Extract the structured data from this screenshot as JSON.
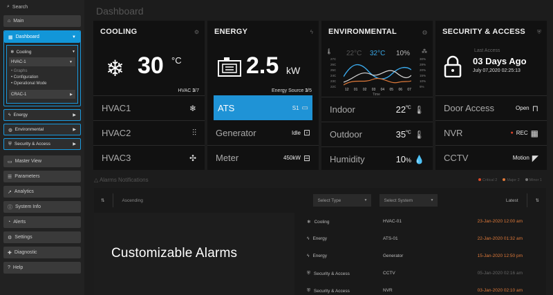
{
  "sidebar": {
    "search_label": "Search",
    "main_label": "Main",
    "dashboard_label": "Dashboard",
    "cooling": {
      "label": "Cooling",
      "select1": "HVAC-1",
      "graphs": "Graphs",
      "configuration": "Configuration",
      "operational_mode": "Operational Mode",
      "select2": "CRAC-1"
    },
    "groups": [
      "Energy",
      "Environmental",
      "Security & Access"
    ],
    "items": [
      "Master View",
      "Parameters",
      "Analytics",
      "System Info",
      "Alerts",
      "Settings",
      "Diagnostic",
      "Help"
    ]
  },
  "page_title": "Dashboard",
  "cards": {
    "cooling": {
      "title": "COOLING",
      "value": "30",
      "unit": "°C",
      "caption_pre": "HVAC",
      "caption_bold": "3",
      "caption_post": "/7",
      "rows": [
        {
          "label": "HVAC1",
          "icon": "snowflake-icon"
        },
        {
          "label": "HVAC2",
          "icon": "airflow-icon"
        },
        {
          "label": "HVAC3",
          "icon": "fan-icon"
        }
      ]
    },
    "energy": {
      "title": "ENERGY",
      "value": "2.5",
      "unit": "kW",
      "caption_pre": "Energy Source ",
      "caption_bold": "3",
      "caption_post": "/5",
      "rows": [
        {
          "label": "ATS",
          "value": "S1",
          "icon": "battery-icon"
        },
        {
          "label": "Generator",
          "value": "Idle",
          "icon": "generator-icon"
        },
        {
          "label": "Meter",
          "value": "450kW",
          "icon": "meter-icon"
        }
      ]
    },
    "environmental": {
      "title": "ENVIRONMENTAL",
      "temp_low": "22°C",
      "temp_high": "32°C",
      "humidity_pct": "10%",
      "left_axis": [
        "27C",
        "26C",
        "25C",
        "24C",
        "23C",
        "22C"
      ],
      "right_axis": [
        "30%",
        "28%",
        "20%",
        "15%",
        "10%",
        "5%"
      ],
      "x_ticks": [
        "12",
        "01",
        "02",
        "03",
        "04",
        "05",
        "06",
        "07"
      ],
      "x_label": "Time",
      "rows": [
        {
          "label": "Indoor",
          "value": "22",
          "unit": "ºC",
          "icon": "thermometer-icon"
        },
        {
          "label": "Outdoor",
          "value": "35",
          "unit": "ºC",
          "icon": "thermometer-icon"
        },
        {
          "label": "Humidity",
          "value": "10",
          "unit": "%",
          "icon": "droplet-icon"
        }
      ]
    },
    "security": {
      "title": "SECURITY & ACCESS",
      "last_access_label": "Last Access",
      "last_access_value": "03 Days Ago",
      "last_access_date": "July 07,2020  02:25:13",
      "rows": [
        {
          "label": "Door Access",
          "value": "Open",
          "icon": "door-icon"
        },
        {
          "label": "NVR",
          "value": "REC",
          "icon": "nvr-icon"
        },
        {
          "label": "CCTV",
          "value": "Motion",
          "icon": "camera-icon"
        }
      ]
    }
  },
  "alarms": {
    "title": "Alarms Notifications",
    "legend": [
      "Critical 2",
      "Major 2",
      "Minor 1"
    ],
    "legend_colors": [
      "#d94a2a",
      "#e07a3a",
      "#777777"
    ],
    "sort_label": "Ascending",
    "type_placeholder": "Select Type",
    "system_placeholder": "Select System",
    "latest_label": "Latest",
    "rows": [
      {
        "type": "Cooling",
        "system": "HVAC-01",
        "date": "23-Jan-2020  12:00 am"
      },
      {
        "type": "Energy",
        "system": "ATS-01",
        "date": "22-Jan-2020  01:32 am"
      },
      {
        "type": "Energy",
        "system": "Generator",
        "date": "15-Jan-2020  12:50 pm"
      },
      {
        "type": "Security & Access",
        "system": "CCTV",
        "date": "05-Jan-2020  02:16 am"
      },
      {
        "type": "Security & Access",
        "system": "NVR",
        "date": "03-Jan-2020  02:10 am"
      }
    ]
  },
  "overlay": "Customizable Alarms"
}
